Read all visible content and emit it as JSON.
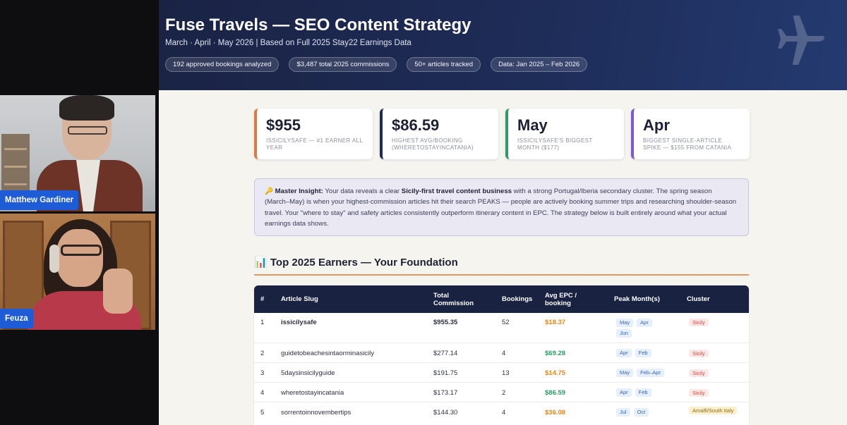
{
  "participants": [
    {
      "name": "Matthew Gardiner"
    },
    {
      "name": "Feuza"
    }
  ],
  "header": {
    "title": "Fuse Travels — SEO Content Strategy",
    "subtitle": "March · April · May 2026  |  Based on Full 2025 Stay22 Earnings Data",
    "pills": [
      "192 approved bookings analyzed",
      "$3,487 total 2025 commissions",
      "50+ articles tracked",
      "Data: Jan 2025 – Feb 2026"
    ]
  },
  "stat_cards": [
    {
      "value": "$955",
      "label": "ISSICILYSAFE — #1 EARNER ALL YEAR",
      "accent": "#e07a3a"
    },
    {
      "value": "$86.59",
      "label": "HIGHEST AVG/BOOKING (WHERETOSTAYINCATANIA)",
      "accent": "#1f2a55"
    },
    {
      "value": "May",
      "label": "ISSICILYSAFE'S BIGGEST MONTH ($177)",
      "accent": "#2f9a63"
    },
    {
      "value": "Apr",
      "label": "BIGGEST SINGLE-ARTICLE SPIKE — $155 FROM CATANIA",
      "accent": "#7a5ad0"
    }
  ],
  "insight": {
    "icon": "🔑",
    "lead": "Master Insight:",
    "text_1": " Your data reveals a clear ",
    "highlight": "Sicily-first travel content business",
    "text_2": " with a strong Portugal/Iberia secondary cluster. The spring season (March–May) is when your highest-commission articles hit their search PEAKS — people are actively booking summer trips and researching shoulder-season travel. Your \"where to stay\" and safety articles consistently outperform itinerary content in EPC. The strategy below is built entirely around what your actual earnings data shows."
  },
  "section": {
    "icon": "📊",
    "title": "Top 2025 Earners — Your Foundation"
  },
  "table": {
    "headers": [
      "#",
      "Article Slug",
      "Total Commission",
      "Bookings",
      "Avg EPC / booking",
      "Peak Month(s)",
      "Cluster"
    ],
    "rows": [
      {
        "num": "1",
        "slug": "issicilysafe",
        "commission": "$955.35",
        "bookings": "52",
        "epc": "$18.37",
        "epc_color": "orange",
        "months": [
          "May",
          "Apr",
          "Jun"
        ],
        "cluster": "Sicily",
        "cluster_tone": "red",
        "bold": true
      },
      {
        "num": "2",
        "slug": "guidetobeachesintaorminasicily",
        "commission": "$277.14",
        "bookings": "4",
        "epc": "$69.28",
        "epc_color": "green",
        "months": [
          "Apr",
          "Feb"
        ],
        "cluster": "Sicily",
        "cluster_tone": "red",
        "bold": false
      },
      {
        "num": "3",
        "slug": "5daysinsicilyguide",
        "commission": "$191.75",
        "bookings": "13",
        "epc": "$14.75",
        "epc_color": "orange",
        "months": [
          "May",
          "Feb–Apr"
        ],
        "cluster": "Sicily",
        "cluster_tone": "red",
        "bold": false
      },
      {
        "num": "4",
        "slug": "wheretostayincatania",
        "commission": "$173.17",
        "bookings": "2",
        "epc": "$86.59",
        "epc_color": "green",
        "months": [
          "Apr",
          "Feb"
        ],
        "cluster": "Sicily",
        "cluster_tone": "red",
        "bold": false
      },
      {
        "num": "5",
        "slug": "sorrentoinnovembertips",
        "commission": "$144.30",
        "bookings": "4",
        "epc": "$36.08",
        "epc_color": "orange",
        "months": [
          "Jul",
          "Oct"
        ],
        "cluster": "Amalfi/South Italy",
        "cluster_tone": "amber",
        "bold": false
      }
    ]
  },
  "colors": {
    "hero": "#1e2c58",
    "accent_rule": "#e4975f",
    "table_header": "#1a2242"
  }
}
